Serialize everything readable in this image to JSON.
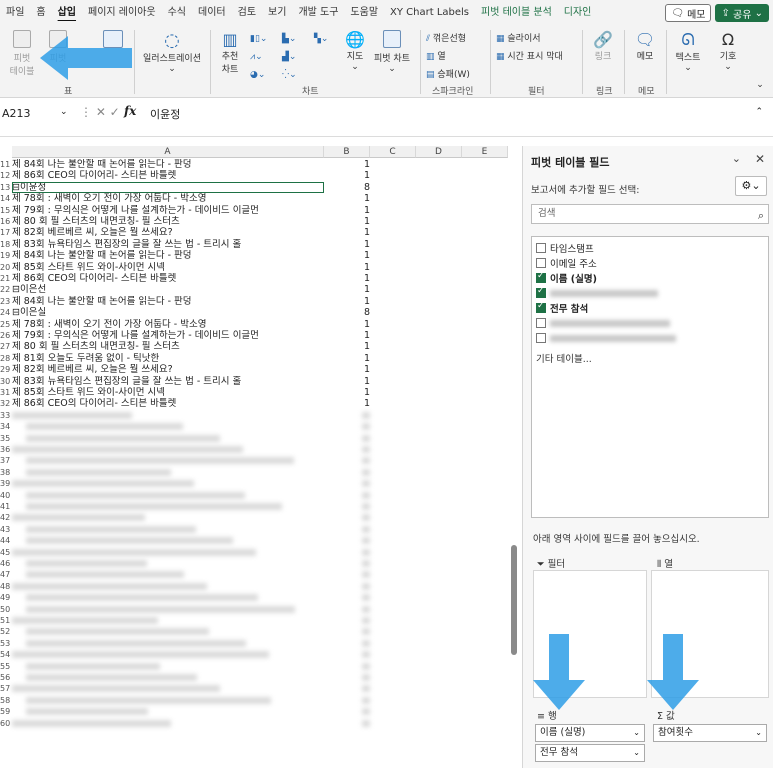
{
  "tabs": [
    "파일",
    "홈",
    "삽입",
    "페이지 레이아웃",
    "수식",
    "데이터",
    "검토",
    "보기",
    "개발 도구",
    "도움말",
    "XY Chart Labels",
    "피벗 테이블 분석",
    "디자인"
  ],
  "active_tab": "삽입",
  "memo_label": "메모",
  "share_label": "공유",
  "ribbon": {
    "pivot1": "피벗\n테이블",
    "pivot2": "피벗",
    "table_group": "표",
    "illustration": "일러스트레이션",
    "recommend_chart": "추천\n차트",
    "map": "지도",
    "pivot_chart": "피벗 차트",
    "chart_group": "차트",
    "spark_line": "꺾은선형",
    "spark_col": "열",
    "spark_winloss": "승패(W)",
    "spark_group": "스파크라인",
    "slicer": "슬라이서",
    "timeline": "시간 표시 막대",
    "filter_group": "필터",
    "link": "링크",
    "link_group": "링크",
    "memo": "메모",
    "memo_group": "메모",
    "text": "텍스트",
    "symbol": "기호"
  },
  "formula_bar": {
    "name_box": "A213",
    "value": "이윤정"
  },
  "columns": [
    "A",
    "B",
    "C",
    "D",
    "E"
  ],
  "rows": [
    {
      "n": "11",
      "a": "   제 84회 나는 불안할 때 논어를 읽는다 - 판덩",
      "b": "1"
    },
    {
      "n": "12",
      "a": "   제 86회 CEO의 다이어리- 스티븐 바틀렛",
      "b": "1"
    },
    {
      "n": "13",
      "a": "⊟이윤정",
      "b": "8"
    },
    {
      "n": "14",
      "a": "   제 78회 : 새벽이 오기 전이 가장 어둡다 - 박소영",
      "b": "1"
    },
    {
      "n": "15",
      "a": "   제 79회 : 무의식은 어떻게 나를 설계하는가 - 데이비드 이글먼",
      "b": "1"
    },
    {
      "n": "16",
      "a": "   제 80 회 필 스터츠의 내면코칭- 필 스터츠",
      "b": "1"
    },
    {
      "n": "17",
      "a": "   제 82회 베르베르 씨, 오늘은 뭘 쓰세요?",
      "b": "1"
    },
    {
      "n": "18",
      "a": "   제 83회 뉴욕타임스 편집장의 글을 잘 쓰는 법 - 트리시 홀",
      "b": "1"
    },
    {
      "n": "19",
      "a": "   제 84회 나는 불안할 때 논어를 읽는다 - 판덩",
      "b": "1"
    },
    {
      "n": "20",
      "a": "   제 85회 스타트 위드 와이-사이먼 시넥",
      "b": "1"
    },
    {
      "n": "21",
      "a": "   제 86회 CEO의 다이어리- 스티븐 바틀렛",
      "b": "1"
    },
    {
      "n": "22",
      "a": "⊟이은선",
      "b": "1"
    },
    {
      "n": "23",
      "a": "   제 84회 나는 불안할 때 논어를 읽는다 - 판덩",
      "b": "1"
    },
    {
      "n": "24",
      "a": "⊟이은실",
      "b": "8"
    },
    {
      "n": "25",
      "a": "   제 78회 : 새벽이 오기 전이 가장 어둡다 - 박소영",
      "b": "1"
    },
    {
      "n": "26",
      "a": "   제 79회 : 무의식은 어떻게 나를 설계하는가 - 데이비드 이글먼",
      "b": "1"
    },
    {
      "n": "27",
      "a": "   제 80 회 필 스터츠의 내면코칭- 필 스터츠",
      "b": "1"
    },
    {
      "n": "28",
      "a": "   제 81회 오늘도 두려움 없이 - 틱낫한",
      "b": "1"
    },
    {
      "n": "29",
      "a": "   제 82회 베르베르 씨, 오늘은 뭘 쓰세요?",
      "b": "1"
    },
    {
      "n": "30",
      "a": "   제 83회 뉴욕타임스 편집장의 글을 잘 쓰는 법 - 트리시 홀",
      "b": "1"
    },
    {
      "n": "31",
      "a": "   제 85회 스타트 위드 와이-사이먼 시넥",
      "b": "1"
    },
    {
      "n": "32",
      "a": "   제 86회 CEO의 다이어리- 스티븐 바틀렛",
      "b": "1"
    }
  ],
  "blurred_rows": [
    "33",
    "34",
    "35",
    "36",
    "37",
    "38",
    "39",
    "40",
    "41",
    "42",
    "43",
    "44",
    "45",
    "46",
    "47",
    "48",
    "49",
    "50",
    "51",
    "52",
    "53",
    "54",
    "55",
    "56",
    "57",
    "58",
    "59",
    "60"
  ],
  "pane": {
    "title": "피벗 테이블 필드",
    "subtitle": "보고서에 추가할 필드 선택:",
    "search_placeholder": "검색",
    "fields": [
      {
        "label": "타임스탬프",
        "checked": false,
        "bold": false
      },
      {
        "label": "이메일 주소",
        "checked": false,
        "bold": false
      },
      {
        "label": "이름 (실명)",
        "checked": true,
        "bold": true
      },
      {
        "label": "(hidden)",
        "checked": true,
        "bold": false,
        "blur": true
      },
      {
        "label": "전무 참석",
        "checked": true,
        "bold": true
      },
      {
        "label": "(hidden)",
        "checked": false,
        "bold": false,
        "blur": true
      },
      {
        "label": "(hidden)",
        "checked": false,
        "bold": false,
        "blur": true
      }
    ],
    "more_tables": "기타 테이블...",
    "drag_hint": "아래 영역 사이에 필드를 끌어 놓으십시오.",
    "filter_label": "필터",
    "columns_label": "열",
    "rows_label": "행",
    "values_label": "값",
    "row_fields": [
      "이름 (실명)",
      "전무 참석"
    ],
    "value_fields": [
      "참여횟수"
    ]
  }
}
